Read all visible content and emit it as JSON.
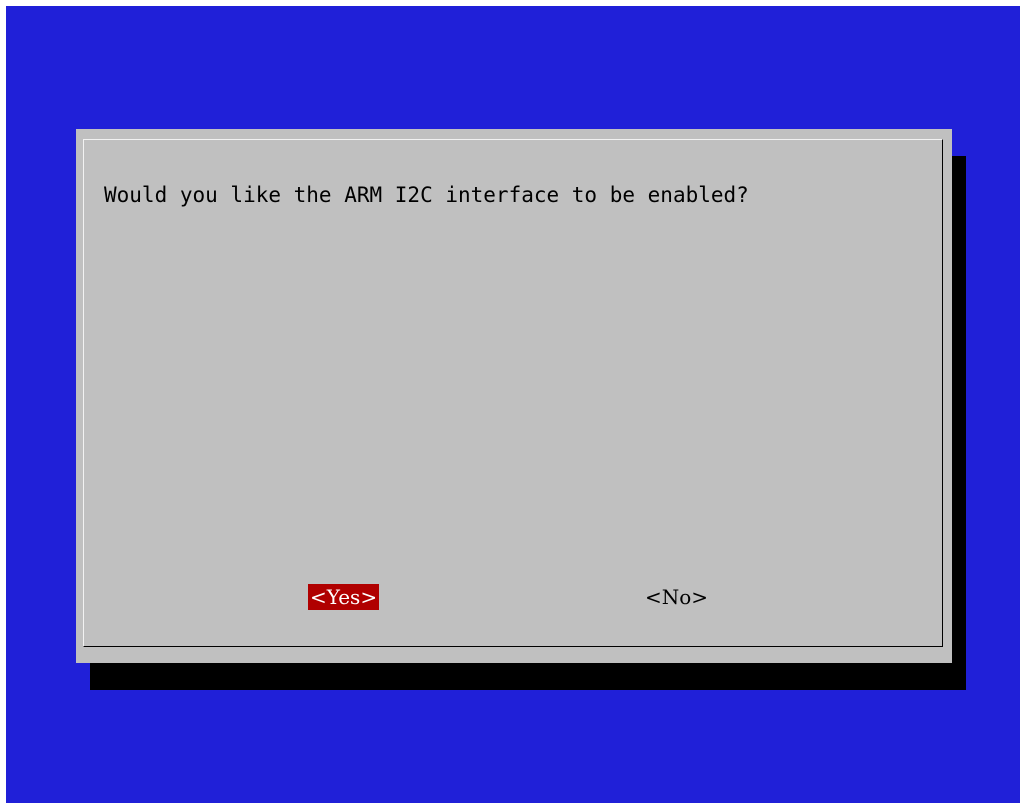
{
  "dialog": {
    "prompt": "Would you like the ARM I2C interface to be enabled?",
    "yes_label": "<Yes>",
    "no_label": "<No>",
    "selected": "yes"
  },
  "colors": {
    "background": "#2020d8",
    "dialog": "#c0c0c0",
    "shadow": "#000000",
    "selected_button": "#b00000",
    "selected_text": "#ffffff",
    "text": "#000000"
  }
}
